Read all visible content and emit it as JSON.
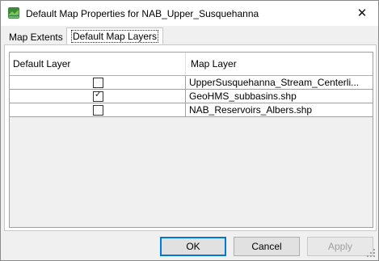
{
  "window": {
    "title": "Default Map Properties for NAB_Upper_Susquehanna",
    "close_glyph": "✕"
  },
  "tabs": [
    {
      "label": "Map Extents",
      "selected": false
    },
    {
      "label": "Default Map Layers",
      "selected": true
    }
  ],
  "table": {
    "columns": [
      "Default Layer",
      "Map Layer"
    ],
    "rows": [
      {
        "default_layer": false,
        "map_layer": "UpperSusquehanna_Stream_Centerli..."
      },
      {
        "default_layer": true,
        "map_layer": "GeoHMS_subbasins.shp"
      },
      {
        "default_layer": false,
        "map_layer": "NAB_Reservoirs_Albers.shp"
      }
    ]
  },
  "buttons": {
    "ok": "OK",
    "cancel": "Cancel",
    "apply": "Apply"
  },
  "check_glyph": "✓",
  "colors": {
    "focus_border": "#0078d7",
    "window_bg": "#f0f0f0",
    "panel_bg": "#ffffff"
  }
}
